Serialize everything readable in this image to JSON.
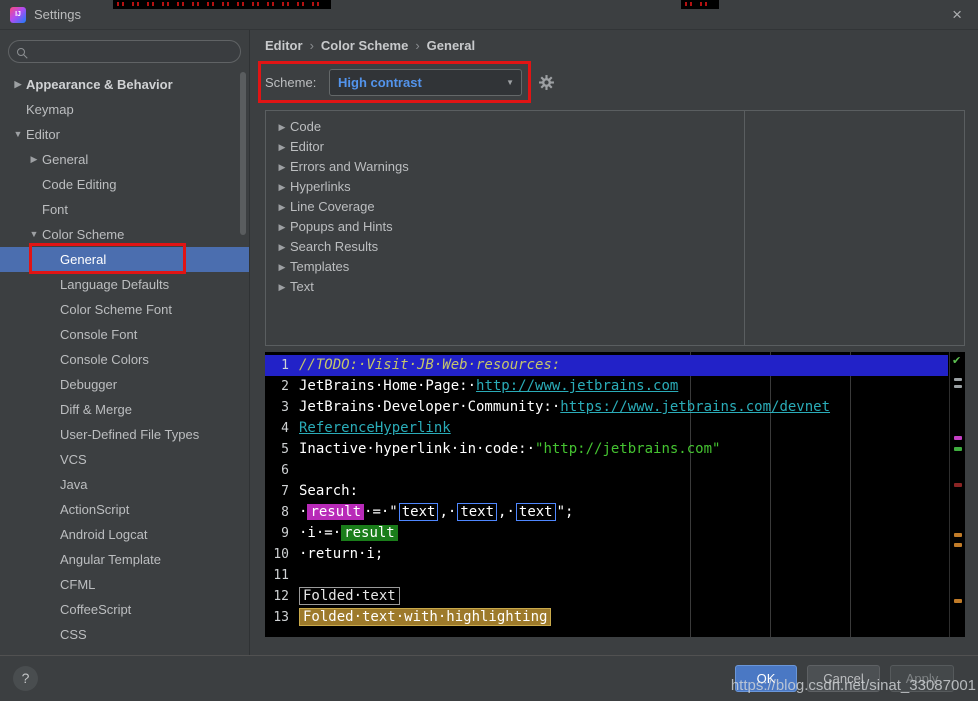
{
  "window": {
    "title": "Settings",
    "close_icon": "×"
  },
  "colors": {
    "selection_blue": "#4b6eaf",
    "annotation_red": "#e11414",
    "scheme_value_blue": "#5394ec",
    "caret_row_blue": "#2222c8",
    "link_teal": "#2aacb8",
    "string_green": "#45c431",
    "todo_yellow": "#c5c66b",
    "search_write_magenta": "#b82ab8",
    "read_access_green": "#1a7d1a",
    "fold_highlight_tan": "#9d7a2b"
  },
  "sidebar": {
    "search_placeholder": "",
    "items": [
      {
        "arrow": "▶",
        "label": "Appearance & Behavior"
      },
      {
        "arrow": "",
        "label": "Keymap"
      },
      {
        "arrow": "▼",
        "label": "Editor"
      },
      {
        "arrow": "▶",
        "label": "General"
      },
      {
        "arrow": "",
        "label": "Code Editing"
      },
      {
        "arrow": "",
        "label": "Font"
      },
      {
        "arrow": "▼",
        "label": "Color Scheme"
      },
      {
        "arrow": "",
        "label": "General"
      },
      {
        "arrow": "",
        "label": "Language Defaults"
      },
      {
        "arrow": "",
        "label": "Color Scheme Font"
      },
      {
        "arrow": "",
        "label": "Console Font"
      },
      {
        "arrow": "",
        "label": "Console Colors"
      },
      {
        "arrow": "",
        "label": "Debugger"
      },
      {
        "arrow": "",
        "label": "Diff & Merge"
      },
      {
        "arrow": "",
        "label": "User-Defined File Types"
      },
      {
        "arrow": "",
        "label": "VCS"
      },
      {
        "arrow": "",
        "label": "Java"
      },
      {
        "arrow": "",
        "label": "ActionScript"
      },
      {
        "arrow": "",
        "label": "Android Logcat"
      },
      {
        "arrow": "",
        "label": "Angular Template"
      },
      {
        "arrow": "",
        "label": "CFML"
      },
      {
        "arrow": "",
        "label": "CoffeeScript"
      },
      {
        "arrow": "",
        "label": "CSS"
      }
    ]
  },
  "breadcrumb": {
    "items": [
      "Editor",
      "Color Scheme",
      "General"
    ],
    "separator": "›"
  },
  "scheme": {
    "label": "Scheme:",
    "value": "High contrast",
    "dropdown_icon": "▼"
  },
  "options_tree": {
    "arrow": "▶",
    "items": [
      "Code",
      "Editor",
      "Errors and Warnings",
      "Hyperlinks",
      "Line Coverage",
      "Popups and Hints",
      "Search Results",
      "Templates",
      "Text"
    ]
  },
  "preview": {
    "check_icon": "✔",
    "lines": [
      {
        "num": "1",
        "segments": [
          {
            "s": "todo",
            "t": "//TODO:·Visit·JB·Web·resources:"
          }
        ]
      },
      {
        "num": "2",
        "segments": [
          {
            "s": "plain",
            "t": "JetBrains·Home·Page:·"
          },
          {
            "s": "link",
            "t": "http://www.jetbrains.com"
          }
        ]
      },
      {
        "num": "3",
        "segments": [
          {
            "s": "plain",
            "t": "JetBrains·Developer·Community:·"
          },
          {
            "s": "link",
            "t": "https://www.jetbrains.com/devnet"
          }
        ]
      },
      {
        "num": "4",
        "segments": [
          {
            "s": "link",
            "t": "ReferenceHyperlink"
          }
        ]
      },
      {
        "num": "5",
        "segments": [
          {
            "s": "plain",
            "t": "Inactive·hyperlink·in·code:·"
          },
          {
            "s": "string",
            "t": "\"http://jetbrains.com\""
          }
        ]
      },
      {
        "num": "6",
        "segments": []
      },
      {
        "num": "7",
        "segments": [
          {
            "s": "plain",
            "t": "Search:"
          }
        ]
      },
      {
        "num": "8",
        "segments": [
          {
            "s": "plain",
            "t": "·"
          },
          {
            "s": "write",
            "t": "result"
          },
          {
            "s": "plain",
            "t": "·=·\""
          },
          {
            "s": "box",
            "t": "text"
          },
          {
            "s": "plain",
            "t": ",·"
          },
          {
            "s": "box",
            "t": "text"
          },
          {
            "s": "plain",
            "t": ",·"
          },
          {
            "s": "box",
            "t": "text"
          },
          {
            "s": "plain",
            "t": "\";"
          }
        ]
      },
      {
        "num": "9",
        "segments": [
          {
            "s": "plain",
            "t": "·i·=·"
          },
          {
            "s": "read",
            "t": "result"
          }
        ]
      },
      {
        "num": "10",
        "segments": [
          {
            "s": "plain",
            "t": "·return·i;"
          }
        ]
      },
      {
        "num": "11",
        "segments": []
      },
      {
        "num": "12",
        "segments": [
          {
            "s": "fold",
            "t": "Folded·text"
          }
        ]
      },
      {
        "num": "13",
        "segments": [
          {
            "s": "foldhl",
            "t": "Folded·text·with·highlighting"
          }
        ]
      }
    ]
  },
  "footer": {
    "help": "?",
    "ok": "OK",
    "cancel": "Cancel",
    "apply": "Apply"
  },
  "watermark": "https://blog.csdn.net/sinat_33087001"
}
